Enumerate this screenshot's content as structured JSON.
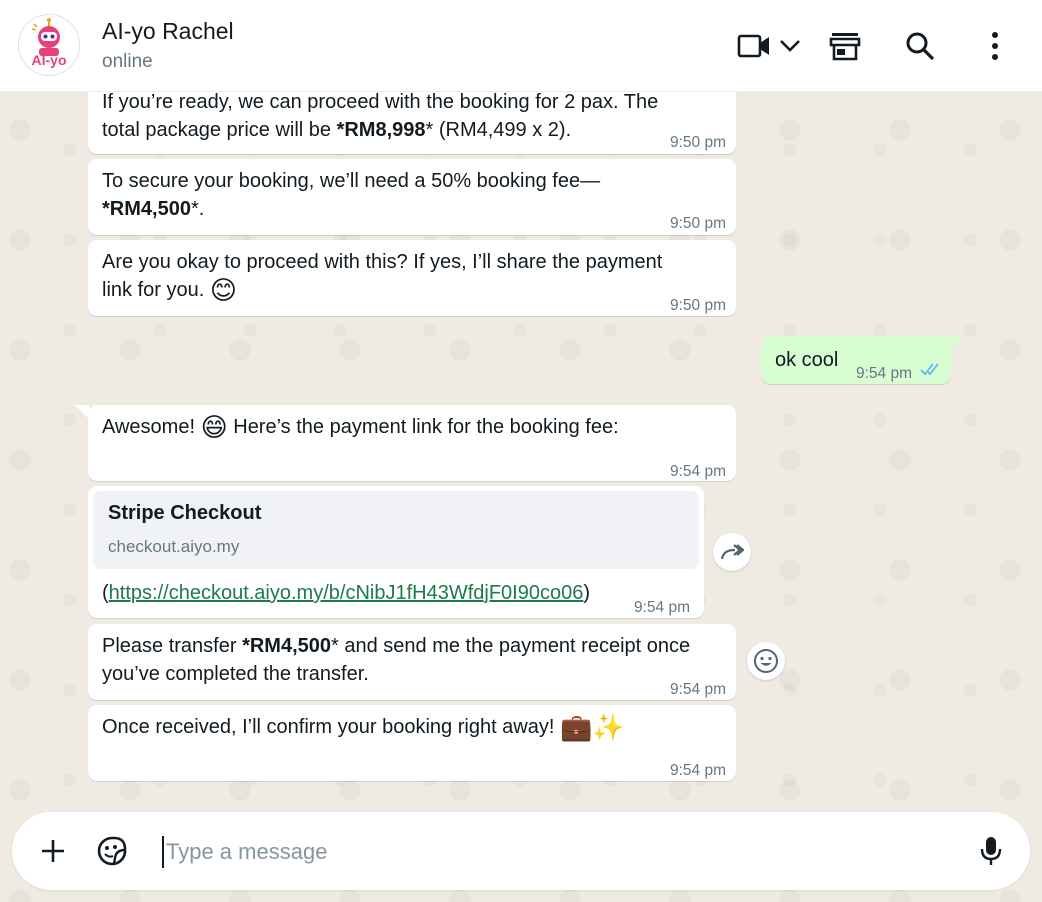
{
  "header": {
    "contact_name": "AI-yo Rachel",
    "status": "online",
    "avatar_text": "AI-yo",
    "icons": [
      "video-call-icon",
      "chevron-down-icon",
      "shop-icon",
      "search-icon",
      "more-options-icon"
    ]
  },
  "messages": [
    {
      "direction": "in",
      "line1": "If you’re ready, we can proceed with the booking for 2 pax. The",
      "line2_prefix": "total package price will be ",
      "line2_bold": "*RM8,998",
      "line2_suffix": "* (RM4,499 x 2).",
      "time": "9:50 pm"
    },
    {
      "direction": "in",
      "line1": "To secure your booking, we’ll need a 50% booking fee—",
      "line2_bold": "*RM4,500",
      "line2_suffix": "*.",
      "time": "9:50 pm"
    },
    {
      "direction": "in",
      "line1": "Are you okay to proceed with this? If yes, I’ll share the payment",
      "line2": "link for you.",
      "emoji": "😊",
      "time": "9:50 pm"
    },
    {
      "direction": "out",
      "text": "ok cool",
      "time": "9:54 pm",
      "read_status": "read"
    },
    {
      "direction": "in",
      "text_prefix": "Awesome! ",
      "emoji": "😄",
      "text_suffix": " Here’s the payment link for the booking fee:",
      "time": "9:54 pm"
    },
    {
      "direction": "in",
      "link_preview_title": "Stripe Checkout",
      "link_preview_domain": "checkout.aiyo.my",
      "open_paren": "(",
      "url": "https://checkout.aiyo.my/b/cNibJ1fH43WfdjF0I90co06",
      "close_paren": ")",
      "time": "9:54 pm"
    },
    {
      "direction": "in",
      "line1_prefix": "Please transfer ",
      "line1_bold": "*RM4,500",
      "line1_suffix": "* and send me the payment receipt once",
      "line2": "you’ve completed the transfer.",
      "time": "9:54 pm"
    },
    {
      "direction": "in",
      "text": "Once received, I’ll confirm your booking right away!",
      "emoji": "💼✨",
      "time": "9:54 pm"
    }
  ],
  "side_buttons": [
    "forward-icon",
    "emoji-reaction-icon"
  ],
  "composer": {
    "placeholder": "Type a message",
    "icons": [
      "plus-icon",
      "sticker-icon",
      "microphone-icon"
    ]
  },
  "colors": {
    "wallpaper": "#efeae2",
    "incoming_bubble": "#ffffff",
    "outgoing_bubble": "#d9fdd3",
    "read_ticks": "#53bdeb",
    "link": "#1d7a4a"
  }
}
